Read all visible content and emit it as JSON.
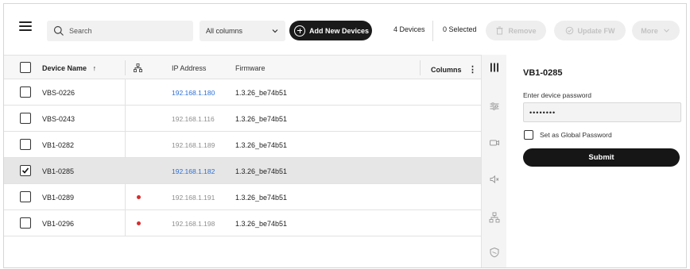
{
  "toolbar": {
    "search_placeholder": "Search",
    "column_filter": "All columns",
    "add_button": "Add New Devices",
    "device_count": "4 Devices",
    "selected_count": "0 Selected",
    "remove_button": "Remove",
    "update_fw_button": "Update FW",
    "more_button": "More"
  },
  "table": {
    "headers": {
      "device_name": "Device Name",
      "ip_address": "IP Address",
      "firmware": "Firmware",
      "columns": "Columns"
    },
    "rows": [
      {
        "device_name": "VBS-0226",
        "ip": "192.168.1.180",
        "firmware": "1.3.26_be74b51"
      },
      {
        "device_name": "VBS-0243",
        "ip": "192.168.1.116",
        "firmware": "1.3.26_be74b51"
      },
      {
        "device_name": "VB1-0282",
        "ip": "192.168.1.189",
        "firmware": "1.3.26_be74b51"
      },
      {
        "device_name": "VB1-0285",
        "ip": "192.168.1.182",
        "firmware": "1.3.26_be74b51"
      },
      {
        "device_name": "VB1-0289",
        "ip": "192.168.1.191",
        "firmware": "1.3.26_be74b51"
      },
      {
        "device_name": "VB1-0296",
        "ip": "192.168.1.198",
        "firmware": "1.3.26_be74b51"
      }
    ]
  },
  "panel": {
    "title": "VB1-0285",
    "password_label": "Enter device password",
    "password_value": "••••••••",
    "global_label": "Set as Global Password",
    "submit_label": "Submit"
  },
  "colors": {
    "accent": "#1a1a1a",
    "link": "#2a6fd6",
    "status_dot": "#d62e2e",
    "disabled": "#c2c2c2"
  }
}
